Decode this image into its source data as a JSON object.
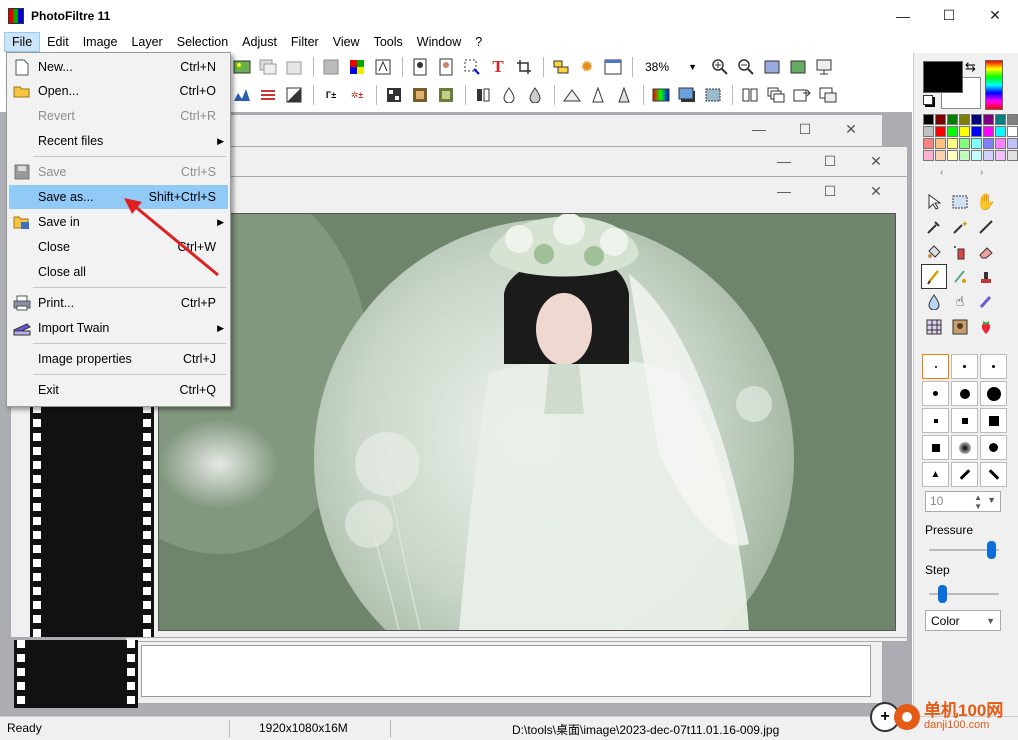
{
  "window": {
    "title": "PhotoFiltre 11",
    "minimize": "—",
    "maximize": "☐",
    "close": "✕"
  },
  "menubar": [
    "File",
    "Edit",
    "Image",
    "Layer",
    "Selection",
    "Adjust",
    "Filter",
    "View",
    "Tools",
    "Window",
    "?"
  ],
  "zoom": {
    "value": "38%"
  },
  "file_menu": [
    {
      "label": "New...",
      "shortcut": "Ctrl+N",
      "icon": "new-document-icon",
      "enabled": true
    },
    {
      "label": "Open...",
      "shortcut": "Ctrl+O",
      "icon": "open-folder-icon",
      "enabled": true
    },
    {
      "label": "Revert",
      "shortcut": "Ctrl+R",
      "enabled": false
    },
    {
      "label": "Recent files",
      "submenu": true,
      "enabled": true
    },
    {
      "label": "Save",
      "shortcut": "Ctrl+S",
      "icon": "save-disk-icon",
      "enabled": false
    },
    {
      "label": "Save as...",
      "shortcut": "Shift+Ctrl+S",
      "highlighted": true,
      "enabled": true
    },
    {
      "label": "Save in",
      "submenu": true,
      "icon": "save-in-icon",
      "enabled": true
    },
    {
      "label": "Close",
      "shortcut": "Ctrl+W",
      "enabled": true
    },
    {
      "label": "Close all",
      "enabled": true
    },
    {
      "label": "Print...",
      "shortcut": "Ctrl+P",
      "icon": "printer-icon",
      "enabled": true
    },
    {
      "label": "Import Twain",
      "submenu": true,
      "icon": "scanner-icon",
      "enabled": true
    },
    {
      "label": "Image properties",
      "shortcut": "Ctrl+J",
      "enabled": true
    },
    {
      "label": "Exit",
      "shortcut": "Ctrl+Q",
      "enabled": true
    }
  ],
  "right_panel": {
    "brush_size": "10",
    "pressure_label": "Pressure",
    "pressure_value": 0.95,
    "step_label": "Step",
    "step_value": 0.15,
    "mode": "Color"
  },
  "status": {
    "state": "Ready",
    "dimensions": "1920x1080x16M",
    "path": "D:\\tools\\桌面\\image\\2023-dec-07t11.01.16-009.jpg"
  },
  "watermark": {
    "site": "单机100网",
    "url": "danji100.com"
  },
  "colors": {
    "highlight": "#91c9f7",
    "menu_active": "#cce4f7",
    "arrow": "#e02020"
  }
}
